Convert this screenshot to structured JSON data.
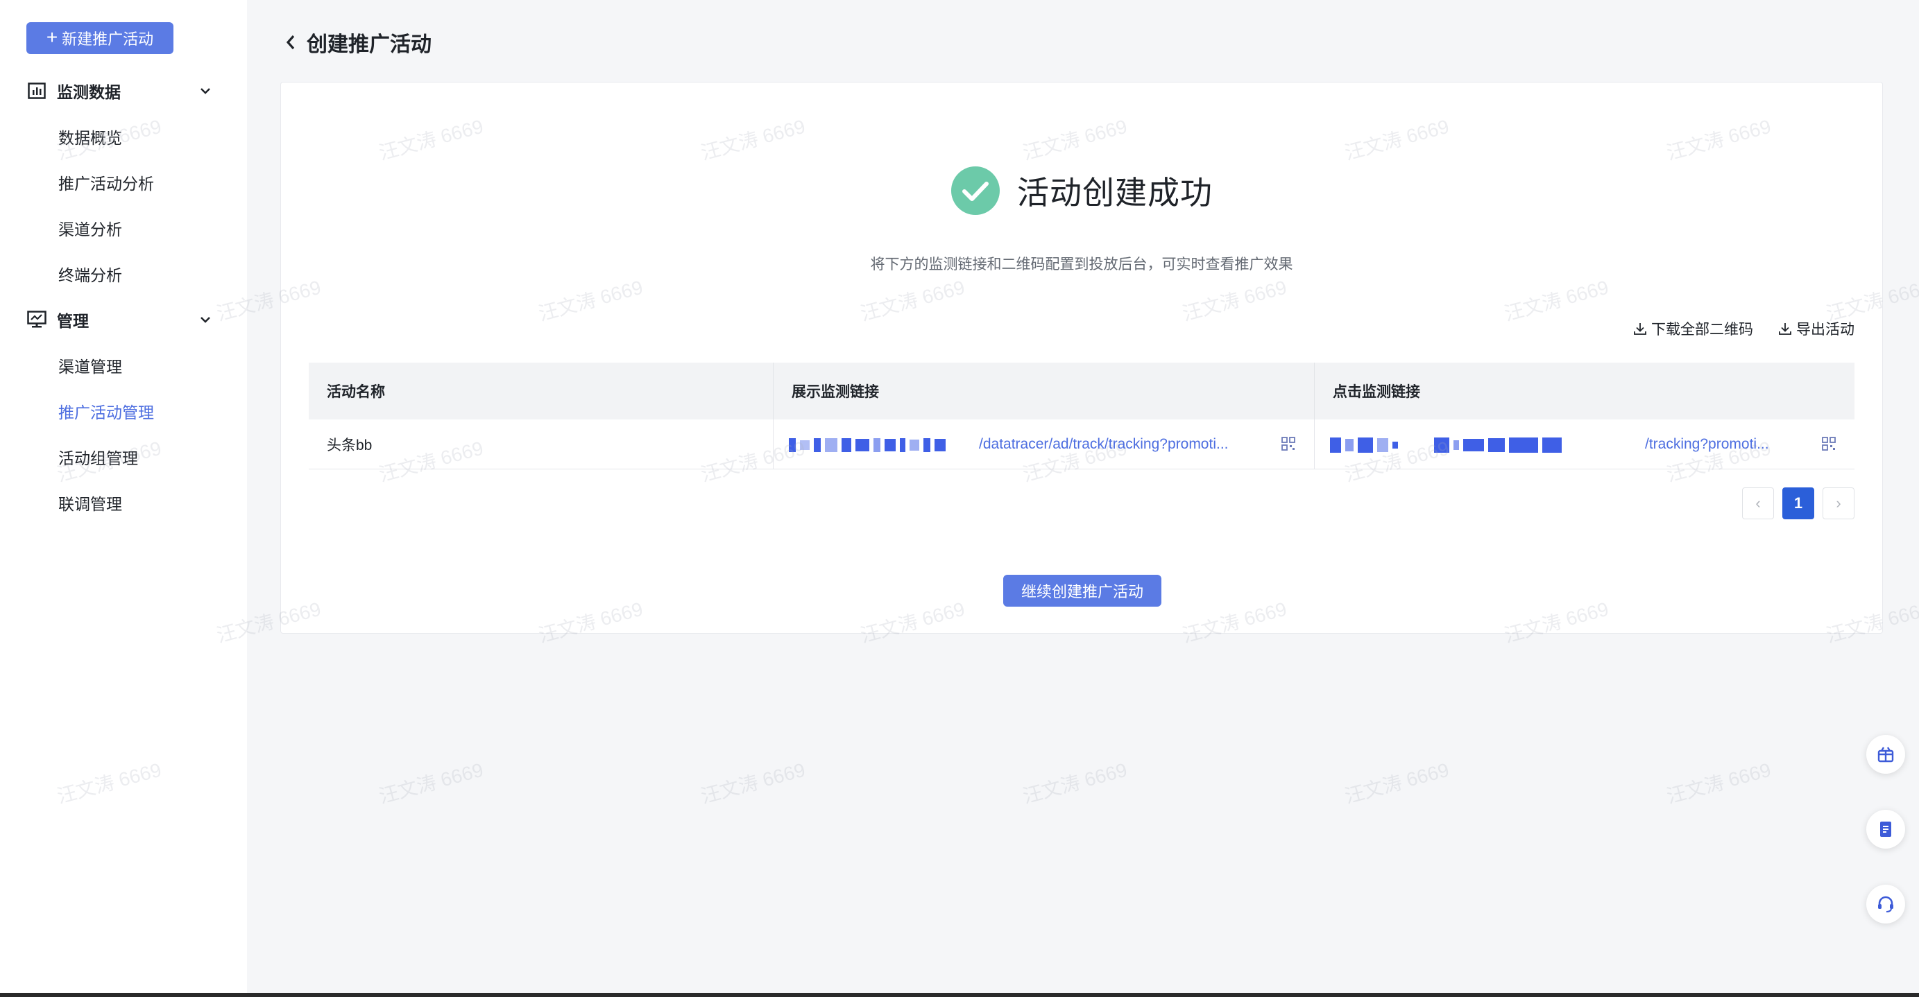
{
  "sidebar": {
    "new_button": "新建推广活动",
    "groups": [
      {
        "label": "监测数据",
        "items": [
          "数据概览",
          "推广活动分析",
          "渠道分析",
          "终端分析"
        ]
      },
      {
        "label": "管理",
        "items": [
          "渠道管理",
          "推广活动管理",
          "活动组管理",
          "联调管理"
        ]
      }
    ],
    "active_item": "推广活动管理"
  },
  "header": {
    "title": "创建推广活动"
  },
  "success": {
    "title": "活动创建成功",
    "subtitle": "将下方的监测链接和二维码配置到投放后台，可实时查看推广效果"
  },
  "actions": {
    "download_qr": "下载全部二维码",
    "export": "导出活动"
  },
  "table": {
    "columns": [
      "活动名称",
      "展示监测链接",
      "点击监测链接"
    ],
    "rows": [
      {
        "name": "头条bb",
        "impression_link": "/datatracer/ad/track/tracking?promoti...",
        "click_link": "/tracking?promoti..."
      }
    ]
  },
  "pagination": {
    "current": "1",
    "prev": "‹",
    "next": "›"
  },
  "continue_button": "继续创建推广活动",
  "watermark": "汪文涛 6669",
  "colors": {
    "primary": "#5b7be4",
    "success": "#6ccaa9",
    "link": "#4d6ee0",
    "active_page": "#2b5fd9"
  }
}
